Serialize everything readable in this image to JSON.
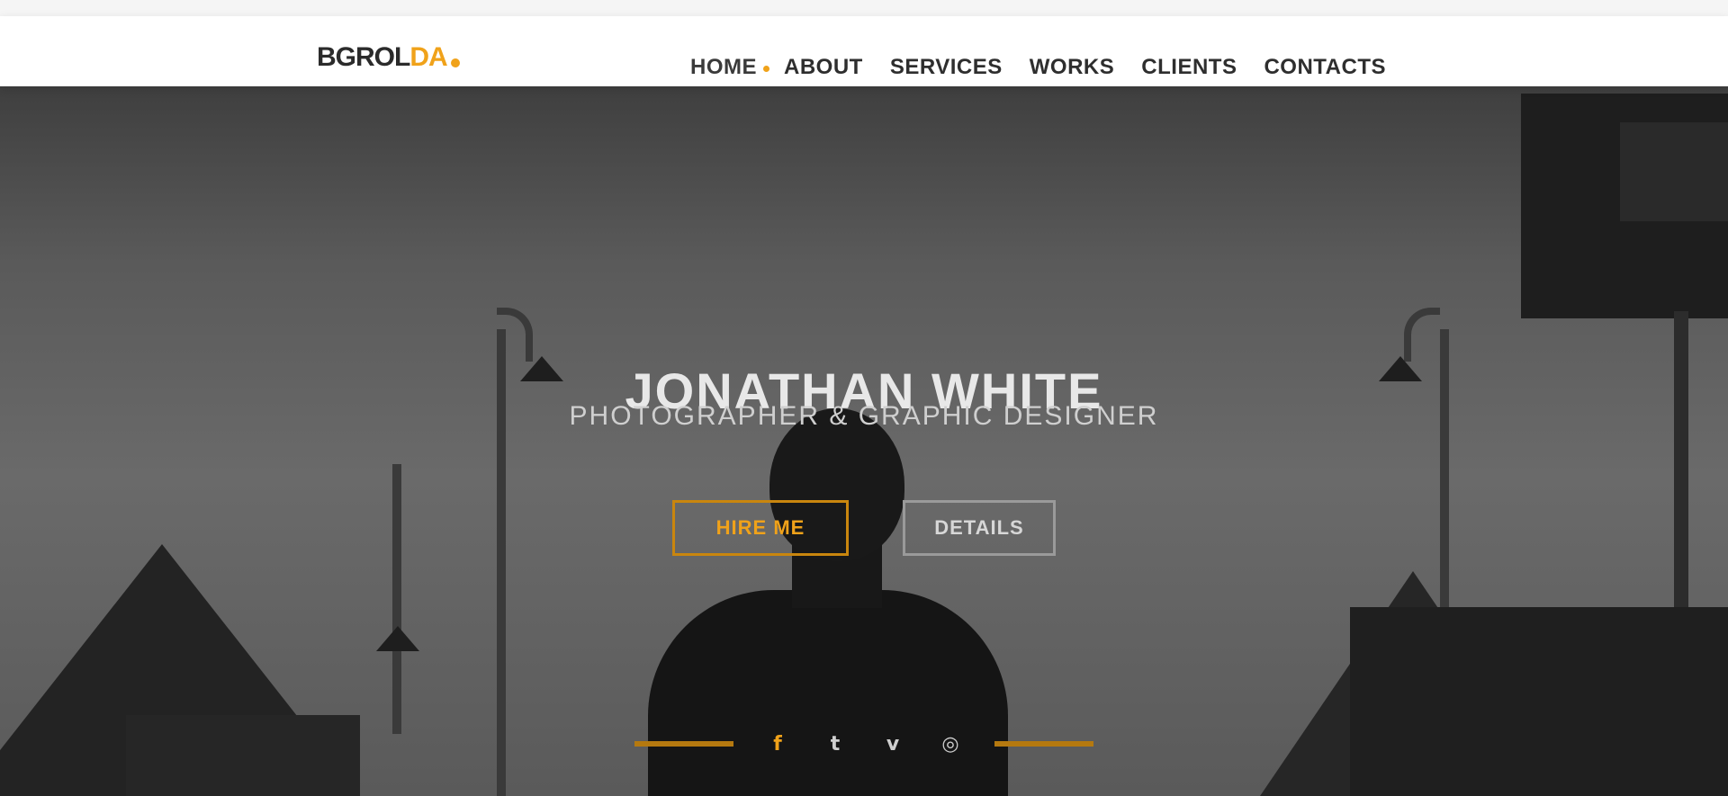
{
  "nav": {
    "logo_text": "BGROL",
    "logo_accent": "DA",
    "items": [
      {
        "label": "HOME",
        "active": true
      },
      {
        "label": "ABOUT",
        "active": false
      },
      {
        "label": "SERVICES",
        "active": false
      },
      {
        "label": "WORKS",
        "active": false
      },
      {
        "label": "CLIENTS",
        "active": false
      },
      {
        "label": "CONTACTS",
        "active": false
      }
    ]
  },
  "hero": {
    "title": "JONATHAN WHITE",
    "subtitle": "PHOTOGRAPHER & GRAPHIC DESIGNER",
    "primary_button": "HIRE ME",
    "secondary_button": "DETAILS",
    "social": [
      {
        "icon": "facebook-icon",
        "glyph": "f",
        "accent": true
      },
      {
        "icon": "twitter-icon",
        "glyph": "t",
        "accent": false
      },
      {
        "icon": "vimeo-icon",
        "glyph": "v",
        "accent": false
      },
      {
        "icon": "instagram-icon",
        "glyph": "◎",
        "accent": false
      }
    ]
  },
  "colors": {
    "accent": "#f0a21a",
    "nav_background": "#ffffff",
    "hero_overlay": "#5a5a5a",
    "text_light": "#e8e8e8"
  }
}
